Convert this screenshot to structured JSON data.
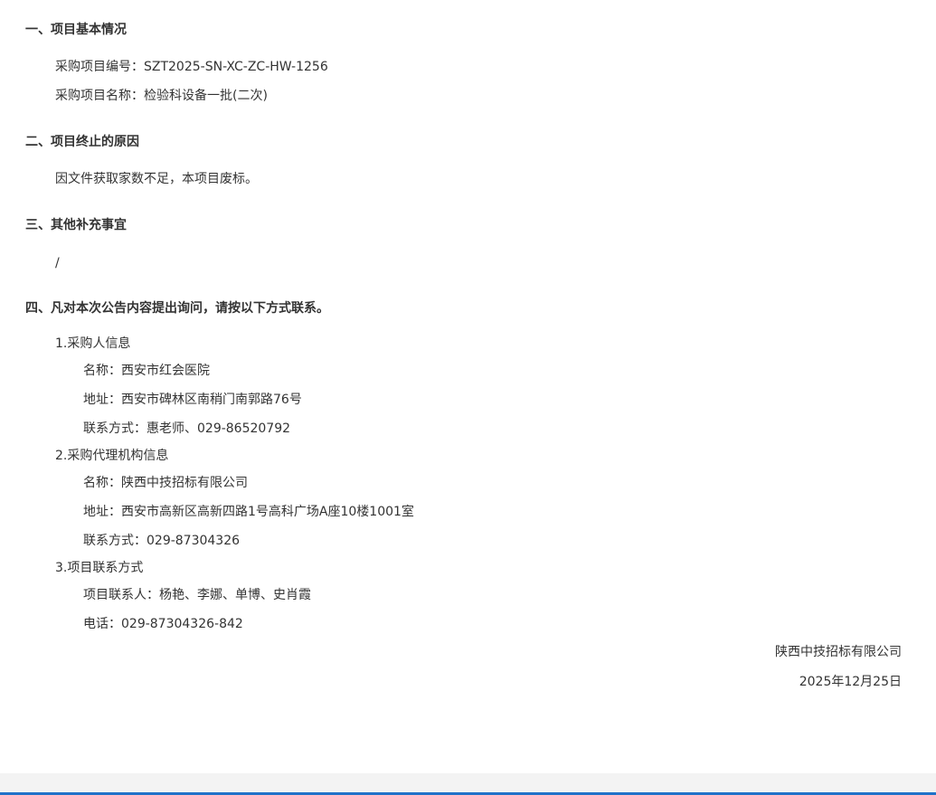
{
  "section1": {
    "heading": "一、项目基本情况",
    "project_no_label": "采购项目编号：",
    "project_no": "SZT2025-SN-XC-ZC-HW-1256",
    "project_name_label": "采购项目名称：",
    "project_name": "检验科设备一批(二次)"
  },
  "section2": {
    "heading": "二、项目终止的原因",
    "reason": "因文件获取家数不足，本项目废标。"
  },
  "section3": {
    "heading": "三、其他补充事宜",
    "content": "/"
  },
  "section4": {
    "heading": "四、凡对本次公告内容提出询问，请按以下方式联系。",
    "purchaser": {
      "title": "1.采购人信息",
      "name": "名称：西安市红会医院",
      "address": "地址：西安市碑林区南稍门南郭路76号",
      "contact": "联系方式：惠老师、029-86520792"
    },
    "agency": {
      "title": "2.采购代理机构信息",
      "name": "名称：陕西中技招标有限公司",
      "address": "地址：西安市高新区高新四路1号高科广场A座10楼1001室",
      "contact": "联系方式：029-87304326"
    },
    "project_contact": {
      "title": "3.项目联系方式",
      "persons": "项目联系人：杨艳、李娜、单博、史肖霞",
      "phone": "电话：029-87304326-842"
    }
  },
  "signature": {
    "company": "陕西中技招标有限公司",
    "date": "2025年12月25日"
  },
  "colors": {
    "text": "#333333",
    "footer_band": "#f3f3f3",
    "footer_rule": "#1f72c9"
  }
}
